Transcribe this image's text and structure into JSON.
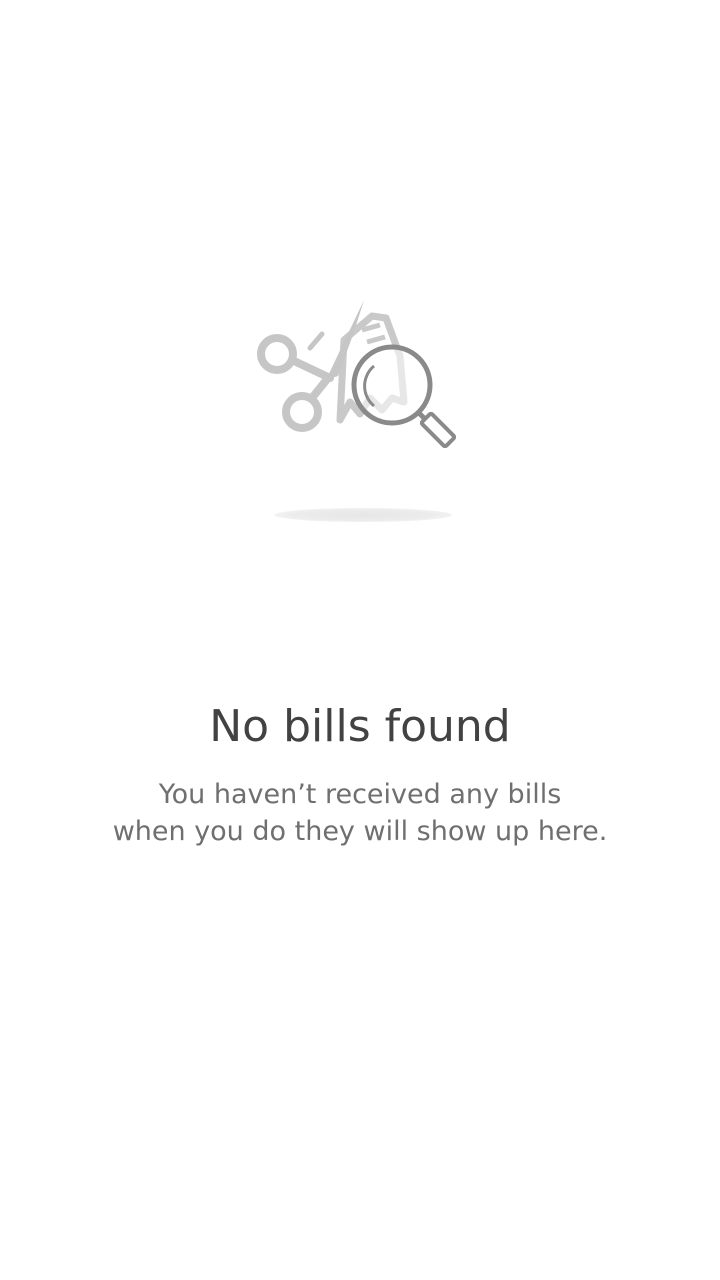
{
  "empty_state": {
    "illustration_icon": "receipt-scissors-magnifier-icon",
    "title": "No bills found",
    "message_line1": "You haven’t received any bills",
    "message_line2": "when you do they will show up here."
  },
  "colors": {
    "background": "#ffffff",
    "title": "#424242",
    "message": "#6f6f6f",
    "illustration_light": "#c8c8c8",
    "illustration_dark": "#8a8a8a"
  }
}
